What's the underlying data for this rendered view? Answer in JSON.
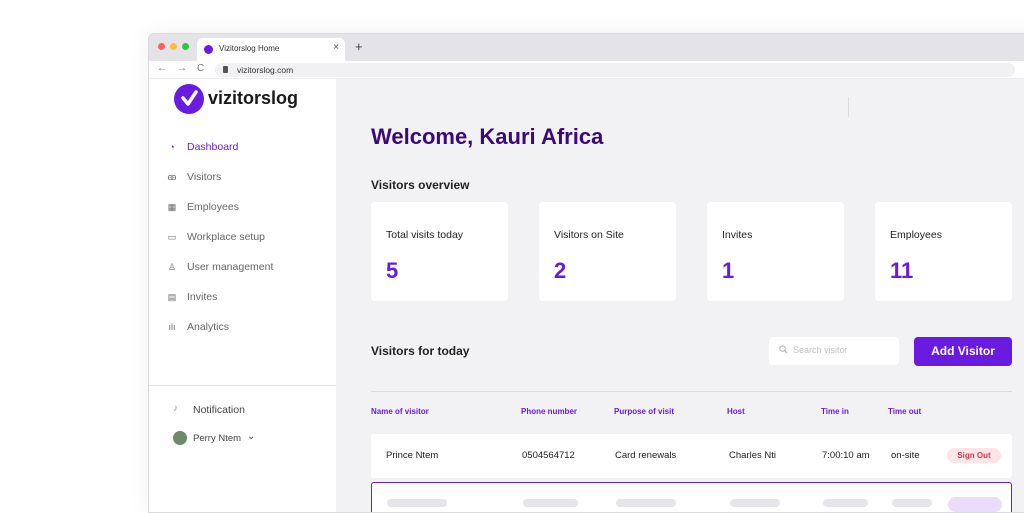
{
  "browser": {
    "tab_title": "Vizitorslog Home",
    "tab_close": "×",
    "new_tab": "+",
    "url": "vizitorslog.com",
    "nav": {
      "back": "←",
      "forward": "→",
      "reload": "C"
    }
  },
  "brand": {
    "name": "vizitorslog",
    "accent": "#6a1be0",
    "heading_color": "#3b0a7a"
  },
  "sidebar": {
    "items": [
      {
        "label": "Dashboard",
        "icon": "dashboard-icon",
        "glyph": "◔"
      },
      {
        "label": "Visitors",
        "icon": "visitors-icon",
        "glyph": "ꙭ"
      },
      {
        "label": "Employees",
        "icon": "employees-icon",
        "glyph": "▦"
      },
      {
        "label": "Workplace setup",
        "icon": "workplace-icon",
        "glyph": "▭"
      },
      {
        "label": "User management",
        "icon": "user-icon",
        "glyph": "♙"
      },
      {
        "label": "Invites",
        "icon": "invites-icon",
        "glyph": "▤"
      },
      {
        "label": "Analytics",
        "icon": "analytics-icon",
        "glyph": "ılı"
      }
    ],
    "notification": {
      "label": "Notification",
      "icon": "bell-icon",
      "glyph": "♪"
    },
    "user": {
      "name": "Perry Ntem",
      "chevron": "⌄"
    }
  },
  "main": {
    "welcome": "Welcome, Kauri Africa",
    "overview_title": "Visitors overview",
    "cards": [
      {
        "label": "Total visits today",
        "value": "5"
      },
      {
        "label": "Visitors on Site",
        "value": "2"
      },
      {
        "label": "Invites",
        "value": "1"
      },
      {
        "label": "Employees",
        "value": "11"
      }
    ],
    "today_title": "Visitors for today",
    "search_placeholder": "Search visitor",
    "add_visitor": "Add Visitor",
    "columns": [
      "Name of visitor",
      "Phone number",
      "Purpose of visit",
      "Host",
      "Time in",
      "Time out"
    ],
    "rows": [
      {
        "name": "Prince Ntem",
        "phone": "0504564712",
        "purpose": "Card renewals",
        "host": "Charles Nti",
        "time_in": "7:00:10 am",
        "time_out": "on-site",
        "action": "Sign Out"
      }
    ]
  }
}
